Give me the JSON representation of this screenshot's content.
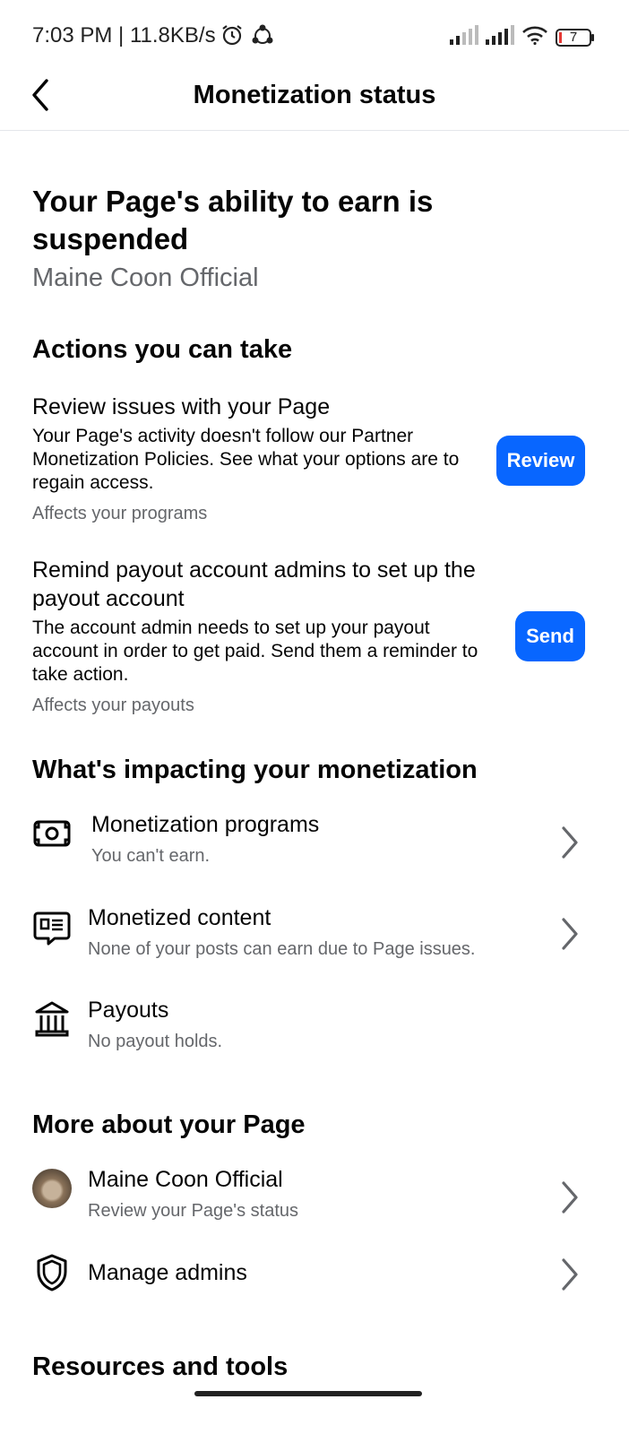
{
  "status_bar": {
    "time": "7:03 PM | 11.8KB/s",
    "battery": "7"
  },
  "app_bar": {
    "title": "Monetization status"
  },
  "hero": {
    "title": "Your Page's ability to earn is suspended",
    "subtitle": "Maine Coon Official"
  },
  "actions_section": {
    "title": "Actions you can take",
    "items": [
      {
        "title": "Review issues with your Page",
        "body": "Your Page's activity doesn't follow our Partner Monetization Policies. See what your options are to regain access.",
        "meta": "Affects your programs",
        "button": "Review"
      },
      {
        "title": "Remind payout account admins to set up the payout account",
        "body": "The account admin needs to set up your payout account in order to get paid. Send them a reminder to take action.",
        "meta": "Affects your payouts",
        "button": "Send"
      }
    ]
  },
  "impact_section": {
    "title": "What's impacting your monetization",
    "items": [
      {
        "icon": "money-icon",
        "title": "Monetization programs",
        "subtitle": "You can't earn."
      },
      {
        "icon": "content-icon",
        "title": "Monetized content",
        "subtitle": "None of your posts can earn due to Page issues."
      },
      {
        "icon": "bank-icon",
        "title": "Payouts",
        "subtitle": "No payout holds."
      }
    ]
  },
  "more_section": {
    "title": "More about your Page",
    "items": [
      {
        "icon": "page-avatar",
        "title": "Maine Coon Official",
        "subtitle": "Review your Page's status"
      },
      {
        "icon": "shield-icon",
        "title": "Manage admins"
      }
    ]
  },
  "resources_section": {
    "title": "Resources and tools"
  },
  "colors": {
    "accent": "#0866ff",
    "secondary_text": "#65676b",
    "primary_text": "#050505"
  }
}
